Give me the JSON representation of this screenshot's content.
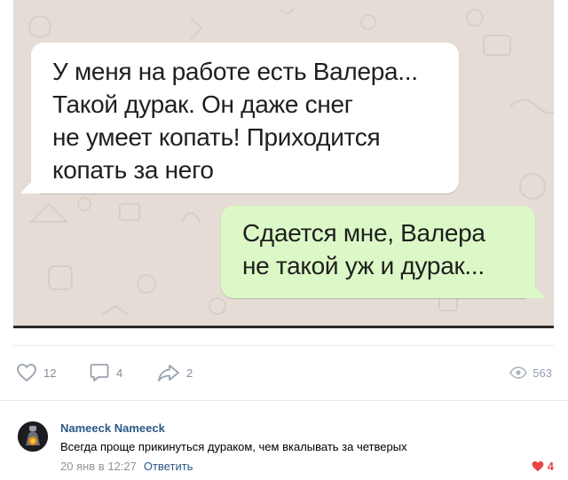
{
  "post": {
    "image": {
      "incoming_lines": [
        "У меня на работе есть Валера...",
        "Такой дурак. Он даже снег",
        "не умеет копать! Приходится",
        "копать за него"
      ],
      "outgoing_lines": [
        "Сдается мне, Валера",
        "не такой уж и дурак..."
      ],
      "bubble_colors": {
        "incoming": "#ffffff",
        "outgoing": "#dcf8c6",
        "wallpaper": "#e5ddd5"
      }
    },
    "actions": {
      "likes": "12",
      "comments": "4",
      "shares": "2",
      "views": "563",
      "icons": {
        "like": "heart-icon",
        "comment": "comment-icon",
        "share": "share-arrow-icon",
        "views": "eye-icon"
      }
    }
  },
  "comment": {
    "author": "Nameeck Nameeck",
    "text": "Всегда проще прикинуться дураком, чем вкалывать за четверых",
    "date": "20 янв в 12:27",
    "reply_label": "Ответить",
    "likes": "4",
    "like_color": "#e64646",
    "link_color": "#2a5885"
  }
}
